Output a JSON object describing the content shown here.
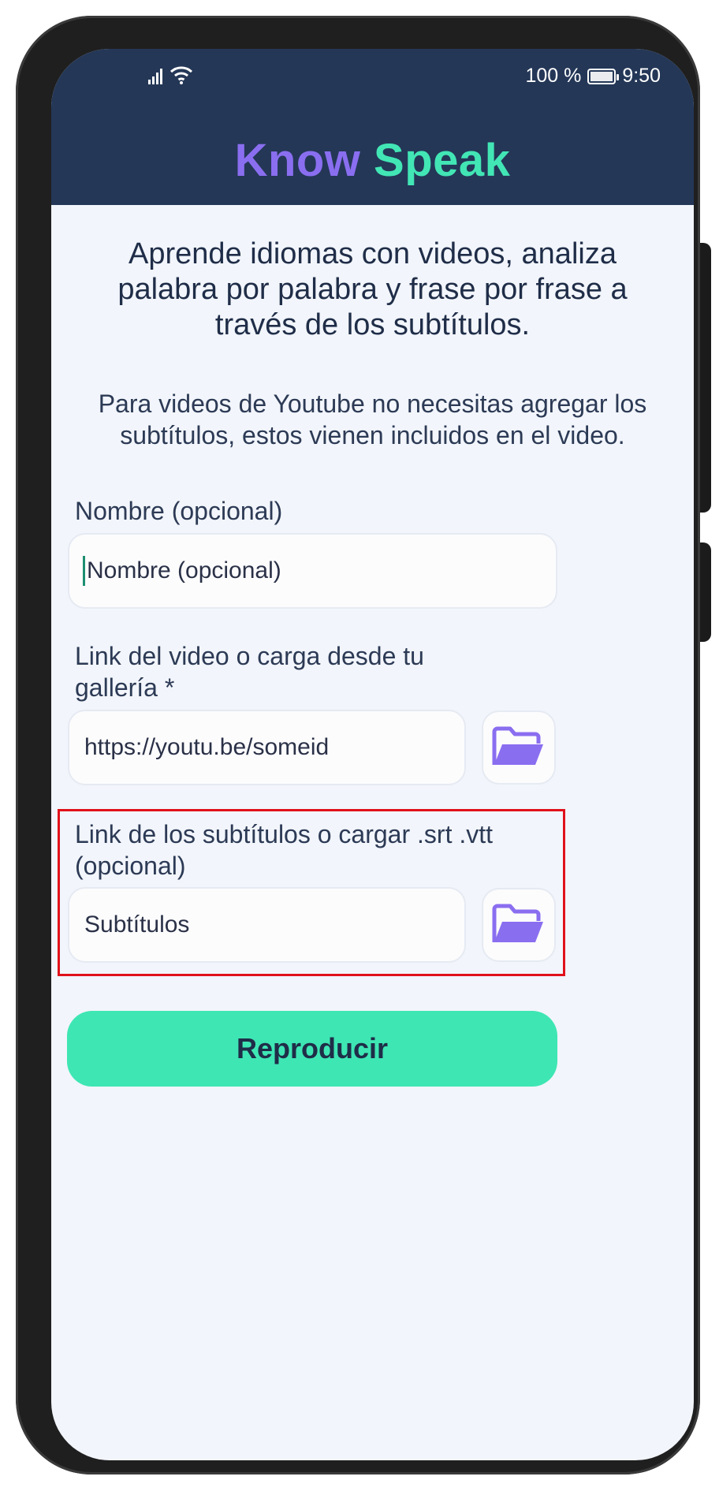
{
  "status_bar": {
    "battery": "100 %",
    "time": "9:50",
    "icons": [
      "signal-icon",
      "wifi-icon",
      "battery-icon"
    ]
  },
  "header": {
    "title_part1": "Know",
    "title_part2": " Speak",
    "title_colors": {
      "know": "#8a6ef0",
      "speak": "#42e6b5",
      "background": "#243757"
    }
  },
  "intro_text": "Aprende idiomas con videos, analiza palabra por palabra y frase por frase a través de los subtítulos.",
  "note_text": "Para videos de Youtube no necesitas agregar los subtítulos, estos vienen incluidos en el video.",
  "form": {
    "name": {
      "label": "Nombre (opcional)",
      "placeholder": "Nombre (opcional)"
    },
    "video": {
      "label": "Link del video o carga desde tu gallería *",
      "value": "https://youtu.be/someid",
      "browse_icon": "folder-open-icon"
    },
    "subtitles": {
      "label": "Link de los subtítulos o cargar .srt .vtt (opcional)",
      "placeholder": "Subtítulos",
      "browse_icon": "folder-open-icon"
    }
  },
  "play_button": {
    "label": "Reproducir",
    "color": "#3ee6b4"
  },
  "highlight_color": "#e0111b"
}
